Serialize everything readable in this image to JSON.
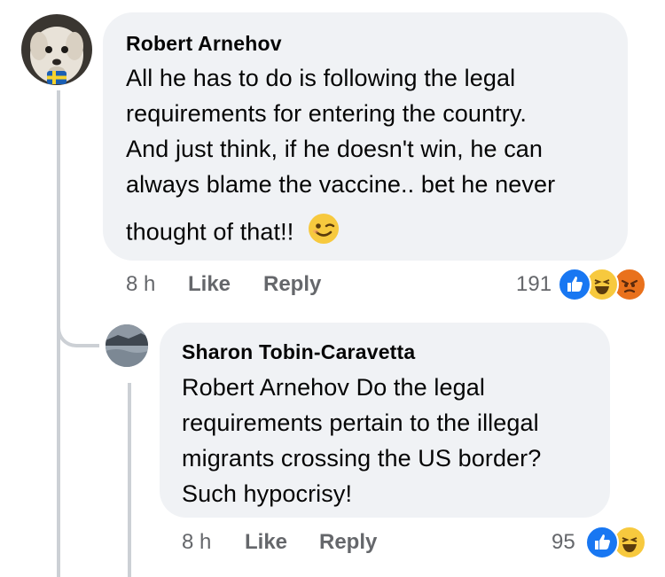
{
  "comment": {
    "author": "Robert Arnehov",
    "text_lines": [
      "All he has to do is following the legal",
      "requirements for entering the country.",
      "And just think, if he doesn't win, he can",
      "always blame the vaccine.. bet he never",
      "thought of that!!"
    ],
    "emoji": "winking-face",
    "time": "8 h",
    "like_label": "Like",
    "reply_label": "Reply",
    "reaction_count": "191",
    "reactions": [
      "like",
      "haha",
      "angry"
    ]
  },
  "reply": {
    "author": "Sharon Tobin-Caravetta",
    "text_lines": [
      "Robert Arnehov Do the legal",
      "requirements pertain to the illegal",
      "migrants crossing the US border?",
      "Such hypocrisy!"
    ],
    "time": "8 h",
    "like_label": "Like",
    "reply_label": "Reply",
    "reaction_count": "95",
    "reactions": [
      "like",
      "haha"
    ]
  },
  "colors": {
    "bubble": "#f0f2f5",
    "meta": "#65676b",
    "like_blue": "#1877f2",
    "haha_yellow": "#f7c93e",
    "angry_orange": "#e9711c"
  }
}
